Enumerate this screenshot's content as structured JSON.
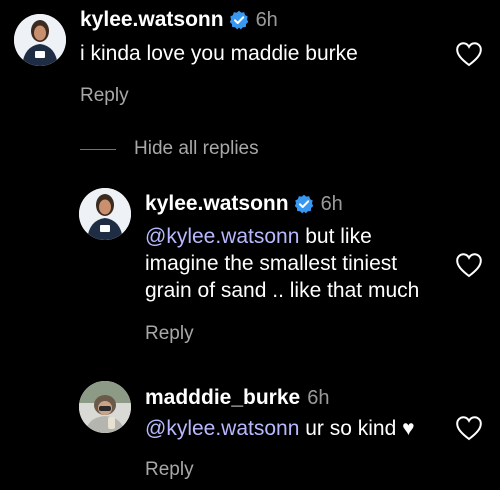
{
  "comments": [
    {
      "username": "kylee.watsonn",
      "verified": true,
      "time": "6h",
      "mention": "",
      "text": "i kinda love you maddie burke",
      "reply_label": "Reply",
      "liked": false
    },
    {
      "username": "kylee.watsonn",
      "verified": true,
      "time": "6h",
      "mention": "@kylee.watsonn",
      "text": " but like imagine the smallest tiniest grain of sand .. like that much",
      "reply_label": "Reply",
      "liked": false
    },
    {
      "username": "madddie_burke",
      "verified": false,
      "time": "6h",
      "mention": "@kylee.watsonn",
      "text": " ur so kind",
      "emoji": "♥",
      "reply_label": "Reply",
      "liked": false
    }
  ],
  "hide_replies_label": "Hide all replies",
  "colors": {
    "background": "#000000",
    "mention": "#b8b8ff",
    "secondary_text": "#a8a8a8",
    "verified": "#3897f0"
  },
  "icons": {
    "verified": "verified-badge-icon",
    "like": "heart-outline-icon"
  }
}
